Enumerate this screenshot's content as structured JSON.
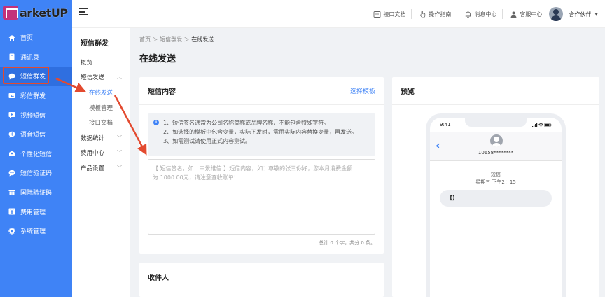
{
  "logo": {
    "text_main": "MarketUP",
    "text_hidden": ""
  },
  "sidebar": {
    "items": [
      {
        "label": "首页"
      },
      {
        "label": "通讯录"
      },
      {
        "label": "短信群发"
      },
      {
        "label": "彩信群发"
      },
      {
        "label": "视频短信"
      },
      {
        "label": "语音短信"
      },
      {
        "label": "个性化短信"
      },
      {
        "label": "短信验证码"
      },
      {
        "label": "国际验证码"
      },
      {
        "label": "费用管理"
      },
      {
        "label": "系统管理"
      }
    ]
  },
  "subnav": {
    "title": "短信群发",
    "items": [
      {
        "label": "概览"
      },
      {
        "label": "短信发送"
      },
      {
        "label": "在线发送"
      },
      {
        "label": "模板管理"
      },
      {
        "label": "接口文档"
      },
      {
        "label": "数据统计"
      },
      {
        "label": "费用中心"
      },
      {
        "label": "产品设置"
      }
    ]
  },
  "topbar": {
    "links": [
      {
        "label": "接口文档"
      },
      {
        "label": "操作指南"
      },
      {
        "label": "消息中心"
      },
      {
        "label": "客服中心"
      }
    ],
    "user": "合作伙伴"
  },
  "breadcrumb": {
    "home": "首页",
    "parent": "短信群发",
    "current": "在线发送"
  },
  "page_title": "在线发送",
  "sms_card": {
    "title": "短信内容",
    "template_link": "选择模板",
    "tips": [
      "1、短信签名通常为公司名称简称或品牌名称，不能包含特殊字符。",
      "2、如选择的模板中包含变量，实际下发时，需用实际内容替换变量，再发送。",
      "3、如需测试请使用正式内容测试。"
    ],
    "placeholder": "【 短信签名，如：中景维信 】短信内容，如：尊敬的张三你好，您本月消费金额为:1000.00元，请注意查收账单!",
    "counter": "总计 0 个字，共分 0 条。"
  },
  "recipient_card": {
    "title": "收件人"
  },
  "preview_card": {
    "title": "预览",
    "time": "9:41",
    "number": "10658********",
    "msg_label": "短信",
    "msg_time": "星期三 下午2：15",
    "bubble": "【】"
  },
  "colors": {
    "accent": "#3f83f6",
    "highlight": "#e34a2f"
  }
}
